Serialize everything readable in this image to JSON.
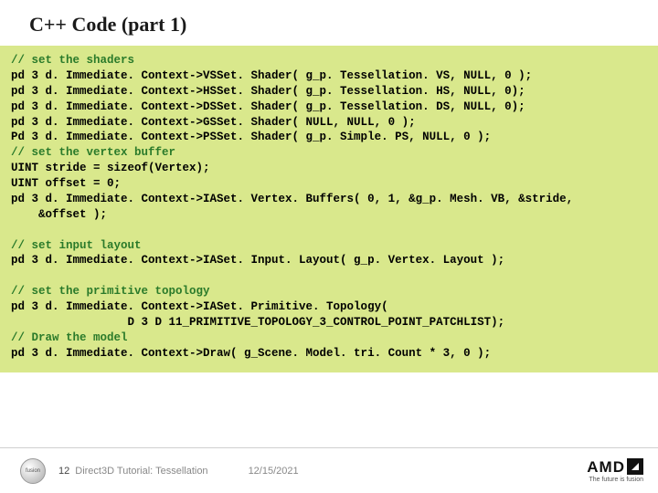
{
  "title": "C++ Code  (part 1)",
  "code": {
    "c1": "// set the shaders",
    "l1": "pd 3 d. Immediate. Context->VSSet. Shader( g_p. Tessellation. VS, NULL, 0 );",
    "l2": "pd 3 d. Immediate. Context->HSSet. Shader( g_p. Tessellation. HS, NULL, 0);",
    "l3": "pd 3 d. Immediate. Context->DSSet. Shader( g_p. Tessellation. DS, NULL, 0);",
    "l4": "pd 3 d. Immediate. Context->GSSet. Shader( NULL, NULL, 0 );",
    "l5": "Pd 3 d. Immediate. Context->PSSet. Shader( g_p. Simple. PS, NULL, 0 );",
    "c2": "// set the vertex buffer",
    "l6": "UINT stride = sizeof(Vertex);",
    "l7": "UINT offset = 0;",
    "l8": "pd 3 d. Immediate. Context->IASet. Vertex. Buffers( 0, 1, &g_p. Mesh. VB, &stride,",
    "l9": "    &offset );",
    "blank1": " ",
    "c3": "// set input layout",
    "l10": "pd 3 d. Immediate. Context->IASet. Input. Layout( g_p. Vertex. Layout );",
    "blank2": " ",
    "c4": "// set the primitive topology",
    "l11": "pd 3 d. Immediate. Context->IASet. Primitive. Topology(",
    "l12": "                 D 3 D 11_PRIMITIVE_TOPOLOGY_3_CONTROL_POINT_PATCHLIST);",
    "c5": "// Draw the model",
    "l13": "pd 3 d. Immediate. Context->Draw( g_Scene. Model. tri. Count * 3, 0 );"
  },
  "footer": {
    "badge_text": "fusion",
    "page_number": "12",
    "tutorial_name": "Direct3D Tutorial: Tessellation",
    "date": "12/15/2021",
    "amd_text": "AMD",
    "amd_tagline": "The future is fusion"
  }
}
